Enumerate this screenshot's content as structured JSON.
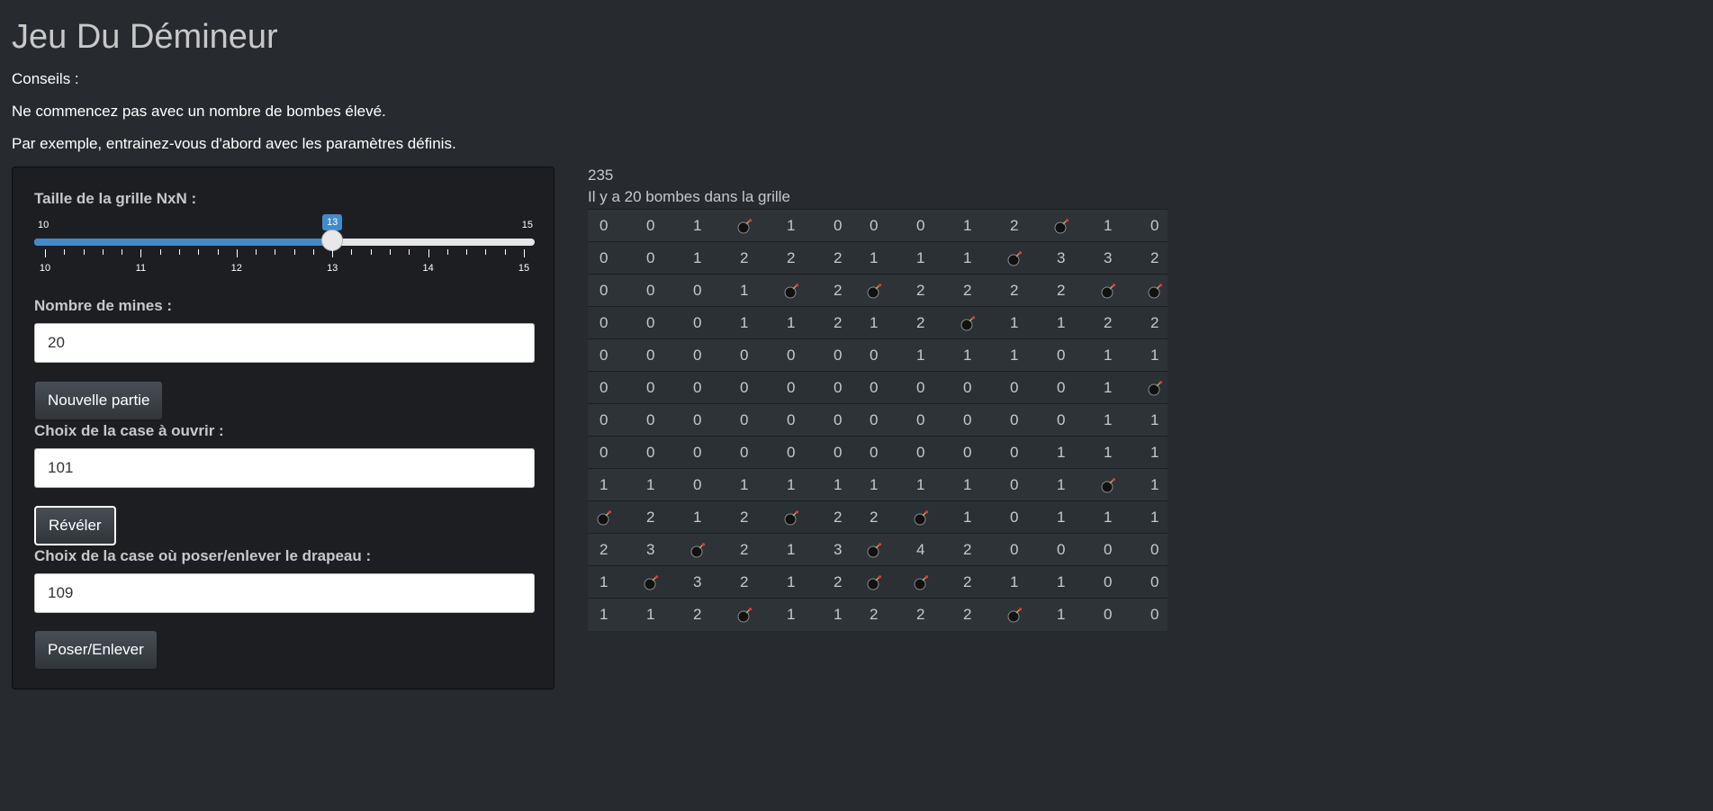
{
  "title": "Jeu Du Démineur",
  "tips": [
    "Conseils :",
    "Ne commencez pas avec un nombre de bombes élevé.",
    "Par exemple, entrainez-vous d'abord avec les paramètres définis."
  ],
  "sidebar": {
    "grid_size_label": "Taille de la grille NxN :",
    "slider": {
      "min": 10,
      "max": 15,
      "value": 13,
      "tick_labels": [
        "10",
        "11",
        "12",
        "13",
        "14",
        "15"
      ],
      "min_label": "10",
      "max_label": "15",
      "value_label": "13"
    },
    "mines_label": "Nombre de mines :",
    "mines_value": "20",
    "new_game_button": "Nouvelle partie",
    "reveal_label": "Choix de la case à ouvrir :",
    "reveal_value": "101",
    "reveal_button": "Révéler",
    "flag_label": "Choix de la case où poser/enlever le drapeau :",
    "flag_value": "109",
    "flag_button": "Poser/Enlever"
  },
  "main": {
    "counter": "235",
    "bombs_message": "Il y a 20 bombes dans la grille",
    "bomb_icon": "bomb-icon",
    "grid": [
      [
        "0",
        "0",
        "1",
        "B",
        "1",
        "0",
        "0",
        "0",
        "1",
        "2",
        "B",
        "1",
        "0"
      ],
      [
        "0",
        "0",
        "1",
        "2",
        "2",
        "2",
        "1",
        "1",
        "1",
        "B",
        "3",
        "3",
        "2"
      ],
      [
        "0",
        "0",
        "0",
        "1",
        "B",
        "2",
        "B",
        "2",
        "2",
        "2",
        "2",
        "B",
        "B"
      ],
      [
        "0",
        "0",
        "0",
        "1",
        "1",
        "2",
        "1",
        "2",
        "B",
        "1",
        "1",
        "2",
        "2"
      ],
      [
        "0",
        "0",
        "0",
        "0",
        "0",
        "0",
        "0",
        "1",
        "1",
        "1",
        "0",
        "1",
        "1"
      ],
      [
        "0",
        "0",
        "0",
        "0",
        "0",
        "0",
        "0",
        "0",
        "0",
        "0",
        "0",
        "1",
        "B"
      ],
      [
        "0",
        "0",
        "0",
        "0",
        "0",
        "0",
        "0",
        "0",
        "0",
        "0",
        "0",
        "1",
        "1"
      ],
      [
        "0",
        "0",
        "0",
        "0",
        "0",
        "0",
        "0",
        "0",
        "0",
        "0",
        "1",
        "1",
        "1"
      ],
      [
        "1",
        "1",
        "0",
        "1",
        "1",
        "1",
        "1",
        "1",
        "1",
        "0",
        "1",
        "B",
        "1"
      ],
      [
        "B",
        "2",
        "1",
        "2",
        "B",
        "2",
        "2",
        "B",
        "1",
        "0",
        "1",
        "1",
        "1"
      ],
      [
        "2",
        "3",
        "B",
        "2",
        "1",
        "3",
        "B",
        "4",
        "2",
        "0",
        "0",
        "0",
        "0"
      ],
      [
        "1",
        "B",
        "3",
        "2",
        "1",
        "2",
        "B",
        "B",
        "2",
        "1",
        "1",
        "0",
        "0"
      ],
      [
        "1",
        "1",
        "2",
        "B",
        "1",
        "1",
        "2",
        "2",
        "2",
        "B",
        "1",
        "0",
        "0"
      ]
    ]
  }
}
